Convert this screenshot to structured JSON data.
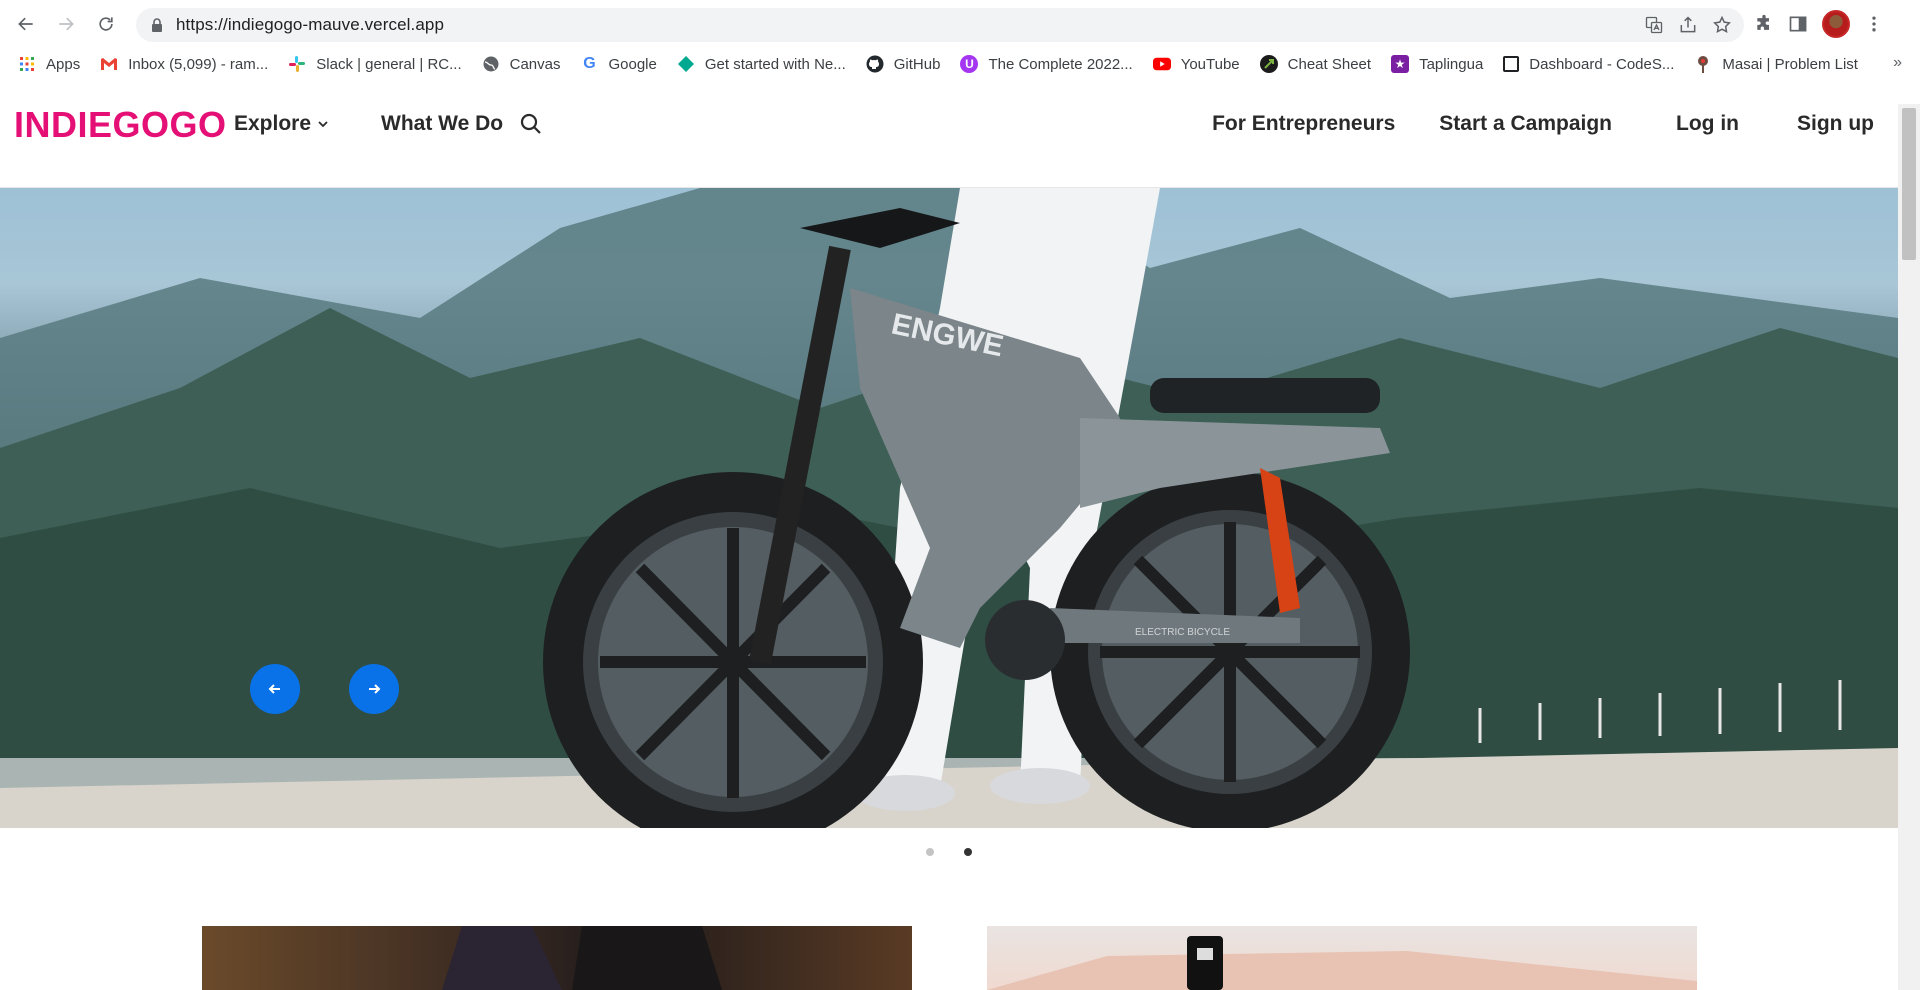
{
  "browser": {
    "url": "https://indiegogo-mauve.vercel.app",
    "bookmarks": [
      {
        "label": "Apps",
        "icon": "apps-grid-icon",
        "color": "#ea4335"
      },
      {
        "label": "Inbox (5,099) - ram...",
        "icon": "gmail-icon",
        "color": "#ea4335"
      },
      {
        "label": "Slack | general | RC...",
        "icon": "slack-icon",
        "color": "#4a154b"
      },
      {
        "label": "Canvas",
        "icon": "globe-icon",
        "color": "#5f6368"
      },
      {
        "label": "Google",
        "icon": "google-icon",
        "color": "#4285f4"
      },
      {
        "label": "Get started with Ne...",
        "icon": "diamond-icon",
        "color": "#00a98f"
      },
      {
        "label": "GitHub",
        "icon": "github-icon",
        "color": "#24292e"
      },
      {
        "label": "The Complete 2022...",
        "icon": "udemy-icon",
        "color": "#a435f0"
      },
      {
        "label": "YouTube",
        "icon": "youtube-icon",
        "color": "#ff0000"
      },
      {
        "label": "Cheat Sheet",
        "icon": "cheatsheet-icon",
        "color": "#1b5e20"
      },
      {
        "label": "Taplingua",
        "icon": "star-icon",
        "color": "#7b1fa2"
      },
      {
        "label": "Dashboard - CodeS...",
        "icon": "square-icon",
        "color": "#202124"
      },
      {
        "label": "Masai | Problem List",
        "icon": "masai-icon",
        "color": "#8d6e63"
      }
    ],
    "more_label": "»"
  },
  "site": {
    "logo": "INDIEGOGO",
    "nav_left": {
      "explore": "Explore",
      "what_we_do": "What We Do"
    },
    "nav_right": {
      "entrepreneurs": "For Entrepreneurs",
      "campaign": "Start a Campaign",
      "login": "Log in",
      "signup": "Sign up"
    },
    "brand_color": "#e51075"
  },
  "hero": {
    "bike_brand_text": "ENGWE",
    "frame_text": "ELECTRIC BICYCLE",
    "slides_total": 2,
    "active_slide": 2,
    "arrow_color": "#0a72e8"
  }
}
